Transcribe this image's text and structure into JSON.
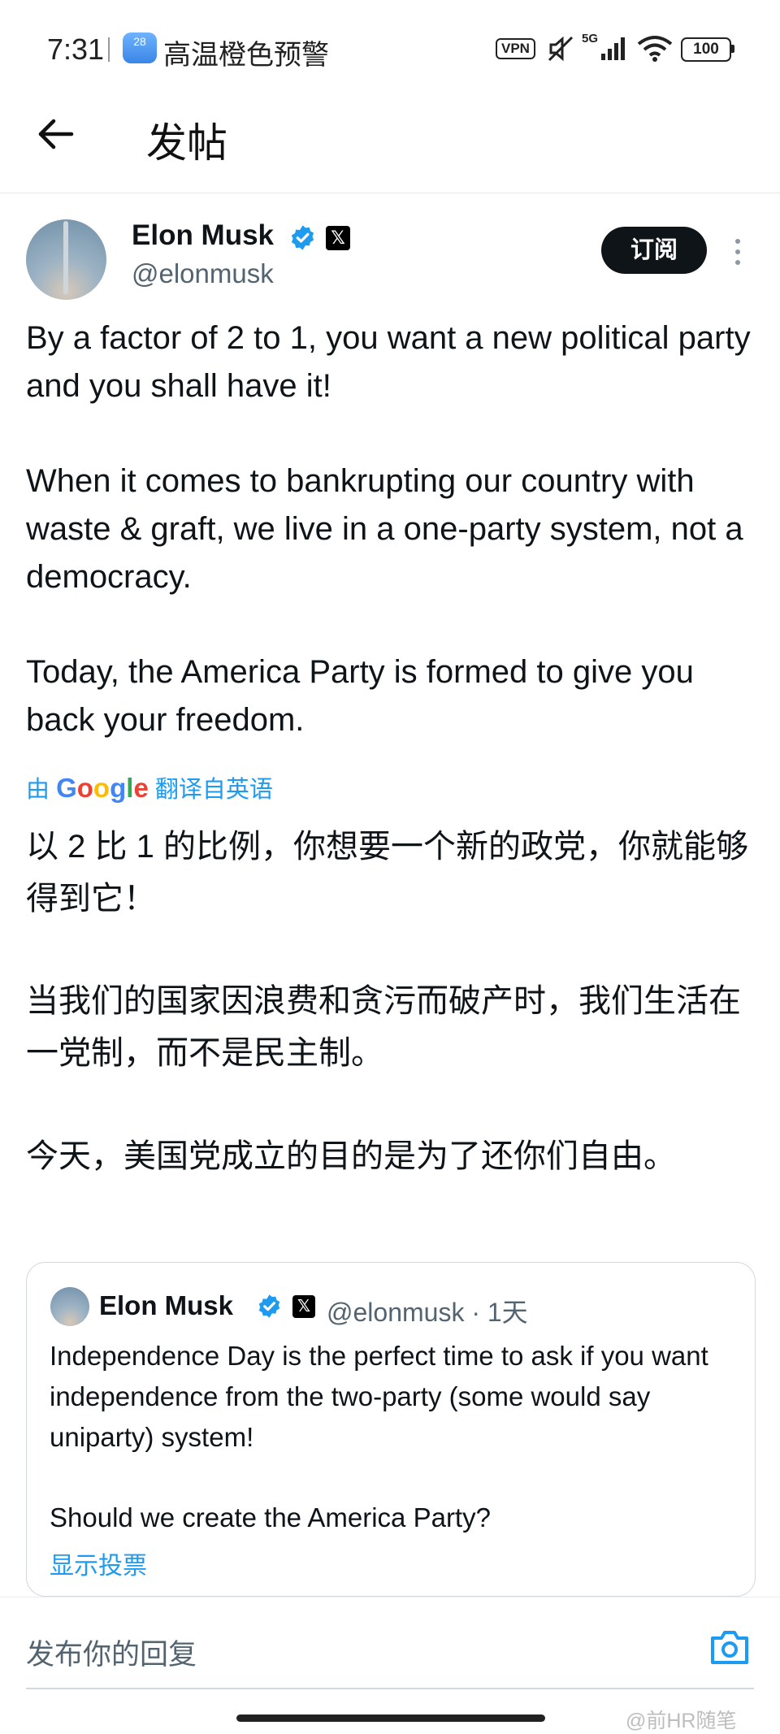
{
  "status_bar": {
    "time": "7:31",
    "weather_badge": "28",
    "weather_alert": "高温橙色预警",
    "vpn": "VPN",
    "network": "5G",
    "battery": "100"
  },
  "header": {
    "title": "发帖"
  },
  "post": {
    "author_name": "Elon Musk",
    "author_handle": "@elonmusk",
    "subscribe_label": "订阅",
    "x_badge": "𝕏",
    "text_en": [
      "By a factor of 2 to 1, you want a new political party and you shall have it!",
      "When it comes to bankrupting our country with waste & graft, we live in a one-party system, not a democracy.",
      "Today, the America Party is formed to give you back your freedom."
    ],
    "translation": {
      "prefix": "由",
      "brand": "Google",
      "suffix": "翻译自英语"
    },
    "text_cn": [
      "以 2 比 1 的比例，你想要一个新的政党，你就能够得到它！",
      "当我们的国家因浪费和贪污而破产时，我们生活在一党制，而不是民主制。",
      "今天，美国党成立的目的是为了还你们自由。"
    ]
  },
  "quote": {
    "author_name": "Elon Musk",
    "x_badge": "𝕏",
    "meta": "@elonmusk · 1天",
    "text": [
      "Independence Day is the perfect time to ask if you want independence from the two-party (some would say uniparty) system!",
      "Should we create the America Party?"
    ],
    "poll_link": "显示投票"
  },
  "reply": {
    "placeholder": "发布你的回复"
  },
  "watermark": "@前HR随笔",
  "colors": {
    "accent": "#1d9bf0",
    "text": "#0f1419",
    "secondary": "#536471"
  }
}
